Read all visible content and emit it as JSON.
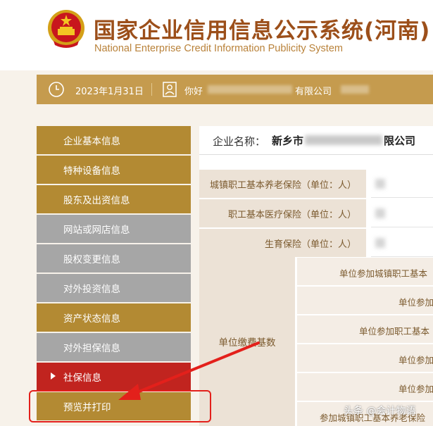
{
  "header": {
    "title_cn": "国家企业信用信息公示系统(河南)",
    "title_en": "National Enterprise Credit Information Publicity System",
    "emblem_icon": "national-emblem-icon"
  },
  "infobar": {
    "date": "2023年1月31日",
    "greeting": "你好",
    "company_suffix": "有限公司",
    "icons": [
      "clock-icon",
      "user-card-icon"
    ]
  },
  "sidebar": {
    "items": [
      {
        "label": "企业基本信息",
        "style": "gold"
      },
      {
        "label": "特种设备信息",
        "style": "gold"
      },
      {
        "label": "股东及出资信息",
        "style": "gold"
      },
      {
        "label": "网站或网店信息",
        "style": "gray"
      },
      {
        "label": "股权变更信息",
        "style": "gray"
      },
      {
        "label": "对外投资信息",
        "style": "gray"
      },
      {
        "label": "资产状态信息",
        "style": "gold"
      },
      {
        "label": "对外担保信息",
        "style": "gray"
      },
      {
        "label": "社保信息",
        "style": "red",
        "active": true
      },
      {
        "label": "预览并打印",
        "style": "gold"
      }
    ]
  },
  "content": {
    "company_label": "企业名称：",
    "company_name_prefix": "新乡市",
    "company_name_suffix": "限公司",
    "rows": [
      "城镇职工基本养老保险（单位：人）",
      "职工基本医疗保险（单位：人）",
      "生育保险（单位：人）"
    ],
    "base_label": "单位缴费基数",
    "sub_rows": [
      "单位参加城镇职工基本",
      "单位参加",
      "单位参加职工基本",
      "单位参加",
      "单位参加",
      "参加城镇职工基本养老保险"
    ]
  },
  "annotation": {
    "box_color": "#e3201b",
    "arrow_color": "#e3201b"
  },
  "watermark": "头条 @会计物语",
  "colors": {
    "gold": "#b38a33",
    "gray": "#a6a6a6",
    "active_red": "#c1241f",
    "infobar": "#c59b4e",
    "title": "#9c4f1a"
  }
}
